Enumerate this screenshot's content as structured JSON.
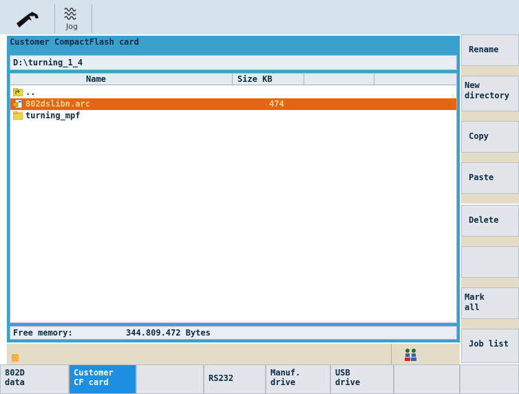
{
  "toolbar": {
    "wrench_icon": "wrench-icon",
    "jog_icon": "jog-waves-icon",
    "jog_label": "Jog"
  },
  "panel": {
    "title": "Customer CompactFlash card",
    "path": "D:\\turning_1_4",
    "columns": [
      "Name",
      "Size KB"
    ],
    "rows": [
      {
        "name": "..",
        "size": "",
        "icon": "folder-up-icon",
        "selected": false
      },
      {
        "name": "802dslibn.arc",
        "size": "474",
        "icon": "archive-file-icon",
        "selected": true
      },
      {
        "name": "turning_mpf",
        "size": "",
        "icon": "folder-icon",
        "selected": false
      }
    ],
    "free_label": "Free memory:",
    "free_value": "344.809.472 Bytes"
  },
  "softkeys_right": [
    "Rename",
    "New\ndirectory",
    "Copy",
    "Paste",
    "Delete",
    "",
    "Mark\nall",
    "Job list"
  ],
  "softkeys_bottom": [
    "802D\ndata",
    "Customer\nCF card",
    "",
    "RS232",
    "Manuf.\ndrive",
    "USB\ndrive",
    "",
    ""
  ],
  "colors": {
    "panel_frame": "#3aa1cf",
    "selection": "#e96410",
    "active_softkey": "#1e8fe0"
  }
}
